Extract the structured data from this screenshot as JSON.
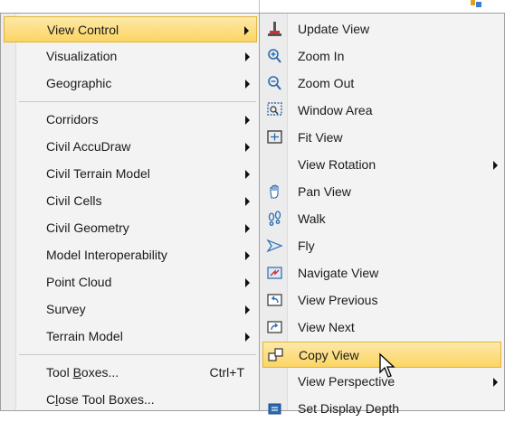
{
  "left_menu": {
    "items": [
      {
        "label": "View Control",
        "highlighted": true
      },
      {
        "label": "Visualization"
      },
      {
        "label": "Geographic"
      },
      {
        "label": "Corridors"
      },
      {
        "label": "Civil AccuDraw"
      },
      {
        "label": "Civil Terrain Model"
      },
      {
        "label": "Civil Cells"
      },
      {
        "label": "Civil Geometry"
      },
      {
        "label": "Model Interoperability"
      },
      {
        "label": "Point Cloud"
      },
      {
        "label": "Survey"
      },
      {
        "label": "Terrain Model"
      }
    ],
    "tool_boxes": {
      "pre": "Tool ",
      "mnemonic": "B",
      "post": "oxes...",
      "shortcut": "Ctrl+T"
    },
    "close_tool_boxes": {
      "pre": "C",
      "mnemonic": "l",
      "post": "ose Tool Boxes..."
    }
  },
  "right_menu": {
    "items": [
      {
        "label": "Update View",
        "icon": "update-view-icon"
      },
      {
        "label": "Zoom In",
        "icon": "zoom-in-icon"
      },
      {
        "label": "Zoom Out",
        "icon": "zoom-out-icon"
      },
      {
        "label": "Window Area",
        "icon": "window-area-icon"
      },
      {
        "label": "Fit View",
        "icon": "fit-view-icon"
      },
      {
        "label": "View Rotation",
        "icon": ""
      },
      {
        "label": "Pan View",
        "icon": "pan-hand-icon"
      },
      {
        "label": "Walk",
        "icon": "footprints-icon"
      },
      {
        "label": "Fly",
        "icon": "fly-icon"
      },
      {
        "label": "Navigate View",
        "icon": "navigate-view-icon"
      },
      {
        "label": "View Previous",
        "icon": "view-previous-icon"
      },
      {
        "label": "View Next",
        "icon": "view-next-icon"
      },
      {
        "label": "Copy View",
        "icon": "copy-view-icon",
        "highlighted": true
      },
      {
        "label": "View Perspective",
        "icon": ""
      },
      {
        "label": "Set Display Depth",
        "icon": "display-depth-icon"
      }
    ]
  },
  "colors": {
    "highlight_top": "#fde9a8",
    "highlight_bottom": "#fbd463",
    "highlight_border": "#e2b43a",
    "menu_bg": "#f3f3f3"
  }
}
